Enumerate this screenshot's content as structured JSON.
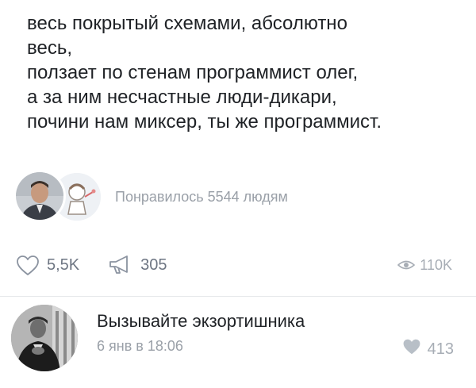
{
  "post": {
    "lines": [
      "весь покрытый схемами, абсолютно",
      "весь,",
      "ползает по стенам программист олег,",
      "а за ним несчастные люди-дикари,",
      "почини нам миксер, ты же программист."
    ]
  },
  "likes_summary": "Понравилось 5544 людям",
  "actions": {
    "likes": "5,5K",
    "shares": "305",
    "views": "110K"
  },
  "comment": {
    "author": "Вызывайте экзортишника",
    "date": "6 янв в 18:06",
    "likes": "413"
  },
  "colors": {
    "text": "#1f2226",
    "muted": "#9aa0a8",
    "icon": "#6e7683",
    "heart_filled": "#b8bfc7"
  },
  "icons": [
    "heart-outline-icon",
    "megaphone-icon",
    "eye-icon",
    "heart-filled-icon"
  ]
}
